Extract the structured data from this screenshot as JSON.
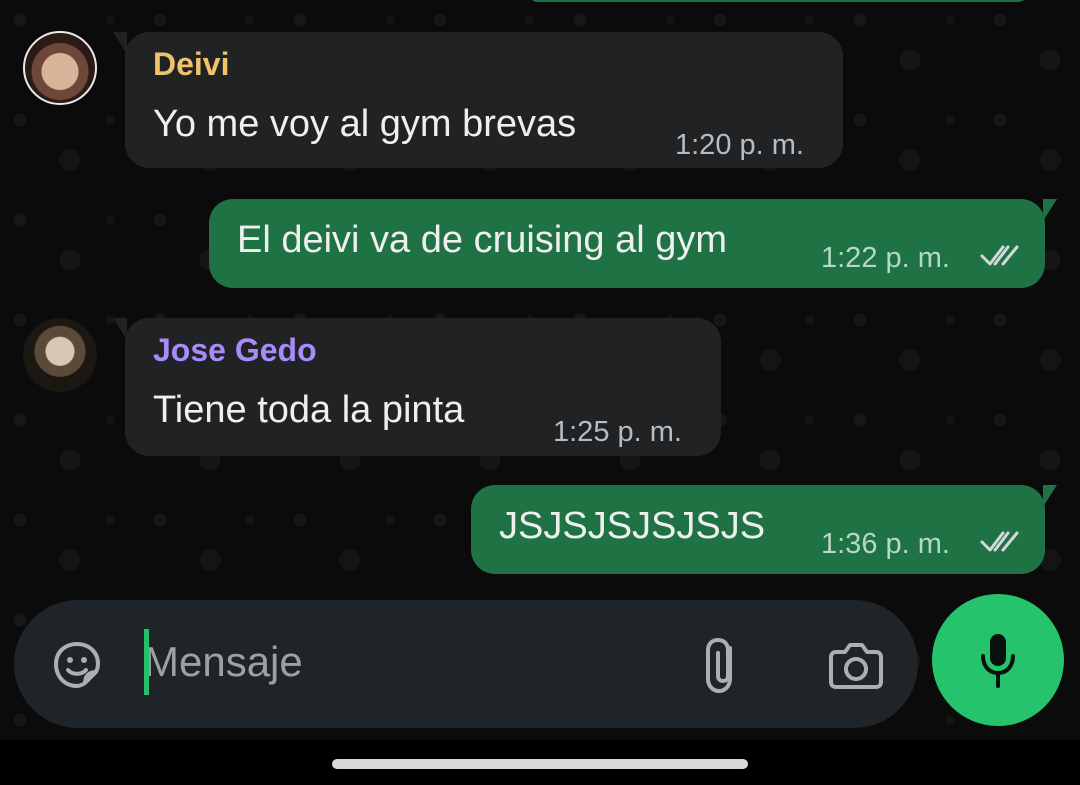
{
  "messages": [
    {
      "direction": "incoming",
      "sender": "Deivi",
      "text": "Yo me voy al gym brevas",
      "time": "1:20 p. m.",
      "sender_color": "#f0c36a"
    },
    {
      "direction": "outgoing",
      "text": "El deivi va de cruising al gym",
      "time": "1:22 p. m.",
      "status": "read"
    },
    {
      "direction": "incoming",
      "sender": "Jose Gedo",
      "text": "Tiene toda la pinta",
      "time": "1:25 p. m.",
      "sender_color": "#a78bfa"
    },
    {
      "direction": "outgoing",
      "text": "JSJSJSJSJSJS",
      "time": "1:36 p. m.",
      "status": "read"
    }
  ],
  "composer": {
    "placeholder": "Mensaje",
    "emoji_icon": "sticker-icon",
    "attach_icon": "paperclip-icon",
    "camera_icon": "camera-icon",
    "mic_icon": "microphone-icon"
  },
  "colors": {
    "background": "#0b0b0b",
    "incoming_bubble": "#202224",
    "outgoing_bubble": "#1f7244",
    "accent": "#24c36c"
  }
}
